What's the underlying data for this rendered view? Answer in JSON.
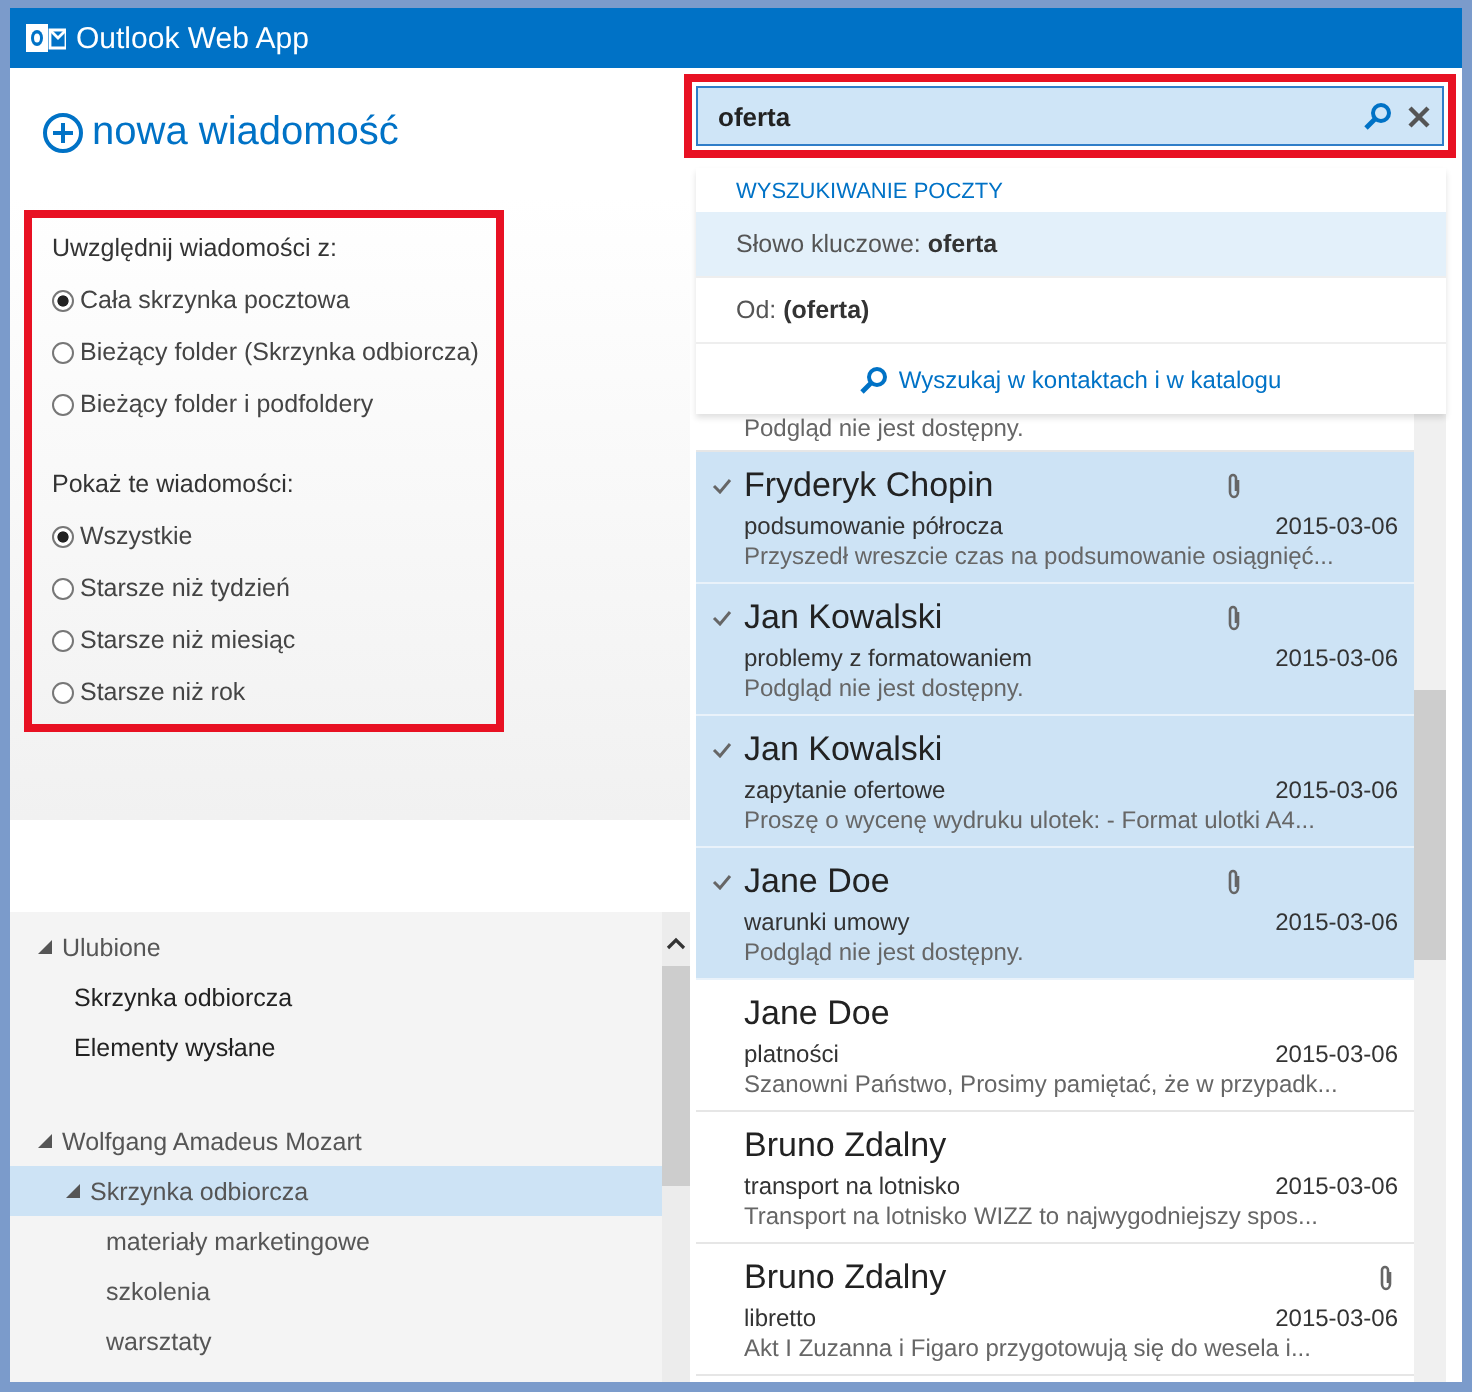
{
  "window": {
    "title": "Outlook Web App"
  },
  "new_message": {
    "label": "nowa wiadomość"
  },
  "filters": [
    {
      "label": "Uwzględnij wiadomości z:",
      "options": [
        {
          "label": "Cała skrzynka pocztowa",
          "selected": true
        },
        {
          "label": "Bieżący folder (Skrzynka odbiorcza)",
          "selected": false
        },
        {
          "label": "Bieżący folder i podfoldery",
          "selected": false
        }
      ]
    },
    {
      "label": "Pokaż te wiadomości:",
      "options": [
        {
          "label": "Wszystkie",
          "selected": true
        },
        {
          "label": "Starsze niż tydzień",
          "selected": false
        },
        {
          "label": "Starsze niż miesiąc",
          "selected": false
        },
        {
          "label": "Starsze niż rok",
          "selected": false
        }
      ]
    }
  ],
  "folders": [
    {
      "label": "Ulubione",
      "expanded": true,
      "selected": false,
      "children": [
        {
          "label": "Skrzynka odbiorcza",
          "selected": false
        },
        {
          "label": "Elementy wysłane",
          "selected": false
        }
      ]
    },
    {
      "label": "Wolfgang Amadeus Mozart",
      "expanded": true,
      "selected": false,
      "children": [
        {
          "label": "Skrzynka odbiorcza",
          "expanded": true,
          "selected": true,
          "children": [
            {
              "label": "materiały marketingowe",
              "selected": false
            },
            {
              "label": "szkolenia",
              "selected": false
            },
            {
              "label": "warsztaty",
              "selected": false
            }
          ]
        }
      ]
    }
  ],
  "search": {
    "value": "oferta"
  },
  "suggestions": {
    "header": "WYSZUKIWANIE POCZTY",
    "items": [
      {
        "label": "Słowo kluczowe: **oferta**",
        "selected": true
      },
      {
        "label": "Od: **(oferta)**",
        "selected": false
      }
    ],
    "link": "Wyszukaj w kontaktach i w katalogu"
  },
  "messages": [
    {
      "preview": "Podgląd nie jest dostępny.",
      "selected": false
    },
    {
      "sender": "Fryderyk Chopin",
      "subject": "podsumowanie półrocza",
      "date": "2015-03-06",
      "preview": "Przyszedł wreszcie czas na podsumowanie osiągnięć...",
      "selected": true,
      "attachment": true
    },
    {
      "sender": "Jan Kowalski",
      "subject": "problemy z formatowaniem",
      "date": "2015-03-06",
      "preview": "Podgląd nie jest dostępny.",
      "selected": true,
      "attachment": true
    },
    {
      "sender": "Jan Kowalski",
      "subject": "zapytanie ofertowe",
      "date": "2015-03-06",
      "preview": "Proszę o wycenę wydruku ulotek: - Format ulotki A4...",
      "selected": true,
      "attachment": false
    },
    {
      "sender": "Jane Doe",
      "subject": "warunki umowy",
      "date": "2015-03-06",
      "preview": "Podgląd nie jest dostępny.",
      "selected": true,
      "attachment": true
    },
    {
      "sender": "Jane Doe",
      "subject": "platności",
      "date": "2015-03-06",
      "preview": "Szanowni Państwo, Prosimy pamiętać, że w przypadk...",
      "selected": false,
      "attachment": false
    },
    {
      "sender": "Bruno Zdalny",
      "subject": "transport na lotnisko",
      "date": "2015-03-06",
      "preview": "Transport na lotnisko WIZZ to najwygodniejszy spos...",
      "selected": false,
      "attachment": false
    },
    {
      "sender": "Bruno Zdalny",
      "subject": "libretto",
      "date": "2015-03-06",
      "preview": "Akt I Zuzanna i Figaro przygotowują się do wesela i...",
      "selected": false,
      "attachment": true
    }
  ]
}
